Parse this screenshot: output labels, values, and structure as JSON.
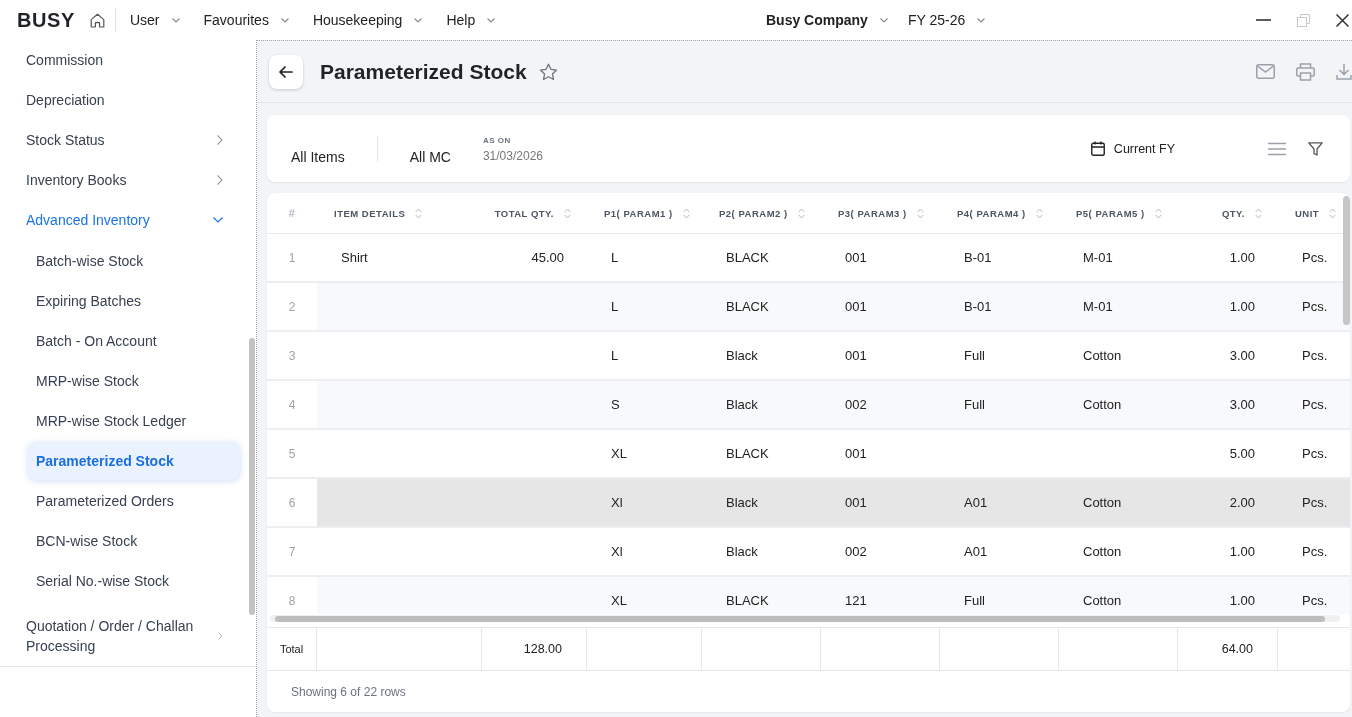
{
  "app_bar": {
    "logo": "BUSY",
    "menus": [
      "User",
      "Favourites",
      "Housekeeping",
      "Help"
    ],
    "company": "Busy Company",
    "financial_year": "FY 25-26"
  },
  "sidebar": {
    "items": [
      {
        "label": "Commission",
        "kind": "link"
      },
      {
        "label": "Depreciation",
        "kind": "link"
      },
      {
        "label": "Stock Status",
        "kind": "group",
        "expanded": false
      },
      {
        "label": "Inventory Books",
        "kind": "group",
        "expanded": false
      },
      {
        "label": "Advanced Inventory",
        "kind": "group",
        "expanded": true,
        "children": [
          {
            "label": "Batch-wise Stock",
            "selected": false
          },
          {
            "label": "Expiring Batches",
            "selected": false
          },
          {
            "label": "Batch - On Account",
            "selected": false
          },
          {
            "label": "MRP-wise Stock",
            "selected": false
          },
          {
            "label": "MRP-wise Stock Ledger",
            "selected": false
          },
          {
            "label": "Parameterized Stock",
            "selected": true
          },
          {
            "label": "Parameterized Orders",
            "selected": false
          },
          {
            "label": "BCN-wise Stock",
            "selected": false
          },
          {
            "label": "Serial No.-wise Stock",
            "selected": false
          }
        ]
      },
      {
        "label": "Quotation / Order / Challan Processing",
        "kind": "group",
        "expanded": false
      }
    ]
  },
  "page": {
    "title": "Parameterized Stock",
    "favourite": false
  },
  "filters": {
    "items": "All Items",
    "material_centre": "All MC",
    "as_on_label": "AS ON",
    "as_on_date": "31/03/2026",
    "period": "Current FY"
  },
  "table": {
    "columns": [
      {
        "label": "#",
        "kind": "index",
        "sortable": false
      },
      {
        "label": "ITEM DETAILS",
        "kind": "text",
        "sortable": true
      },
      {
        "label": "TOTAL QTY.",
        "kind": "number",
        "sortable": true
      },
      {
        "label": "P1( PARAM1 )",
        "kind": "text",
        "sortable": true
      },
      {
        "label": "P2( PARAM2 )",
        "kind": "text",
        "sortable": true
      },
      {
        "label": "P3( PARAM3 )",
        "kind": "text",
        "sortable": true
      },
      {
        "label": "P4( PARAM4 )",
        "kind": "text",
        "sortable": true
      },
      {
        "label": "P5( PARAM5 )",
        "kind": "text",
        "sortable": true
      },
      {
        "label": "QTY.",
        "kind": "number",
        "sortable": true
      },
      {
        "label": "UNIT",
        "kind": "text",
        "sortable": true
      }
    ],
    "rows": [
      {
        "number": "1",
        "item_details": "Shirt",
        "total_qty": "45.00",
        "p1": "L",
        "p2": "BLACK",
        "p3": "001",
        "p4": "B-01",
        "p5": "M-01",
        "qty": "1.00",
        "unit": "Pcs.",
        "selected": false
      },
      {
        "number": "2",
        "p1": "L",
        "p2": "BLACK",
        "p3": "001",
        "p4": "B-01",
        "p5": "M-01",
        "qty": "1.00",
        "unit": "Pcs.",
        "selected": false
      },
      {
        "number": "3",
        "p1": "L",
        "p2": "Black",
        "p3": "001",
        "p4": "Full",
        "p5": "Cotton",
        "qty": "3.00",
        "unit": "Pcs.",
        "selected": false
      },
      {
        "number": "4",
        "p1": "S",
        "p2": "Black",
        "p3": "002",
        "p4": "Full",
        "p5": "Cotton",
        "qty": "3.00",
        "unit": "Pcs.",
        "selected": false
      },
      {
        "number": "5",
        "p1": "XL",
        "p2": "BLACK",
        "p3": "001",
        "qty": "5.00",
        "unit": "Pcs.",
        "selected": false
      },
      {
        "number": "6",
        "p1": "Xl",
        "p2": "Black",
        "p3": "001",
        "p4": "A01",
        "p5": "Cotton",
        "qty": "2.00",
        "unit": "Pcs.",
        "selected": true
      },
      {
        "number": "7",
        "p1": "Xl",
        "p2": "Black",
        "p3": "002",
        "p4": "A01",
        "p5": "Cotton",
        "qty": "1.00",
        "unit": "Pcs.",
        "selected": false
      },
      {
        "number": "8",
        "p1": "XL",
        "p2": "BLACK",
        "p3": "121",
        "p4": "Full",
        "p5": "Cotton",
        "qty": "1.00",
        "unit": "Pcs.",
        "selected": false
      }
    ],
    "total": {
      "label": "Total",
      "total_qty": "128.00",
      "qty": "64.00"
    },
    "footer": "Showing 6 of 22 rows"
  }
}
